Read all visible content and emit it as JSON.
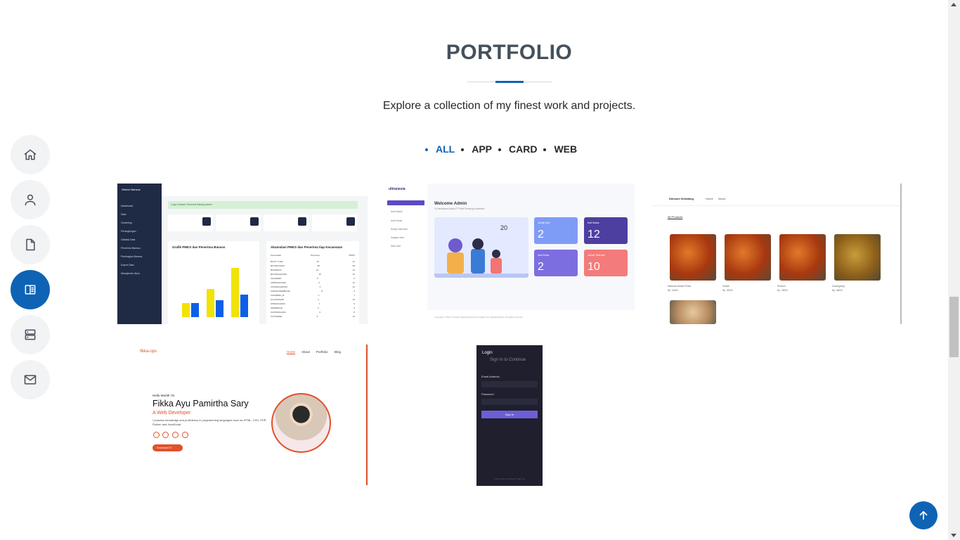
{
  "section": {
    "title": "PORTFOLIO",
    "subtitle": "Explore a collection of my finest work and projects."
  },
  "filters": [
    {
      "label": "ALL",
      "active": true
    },
    {
      "label": "APP",
      "active": false
    },
    {
      "label": "CARD",
      "active": false
    },
    {
      "label": "WEB",
      "active": false
    }
  ],
  "nav_rail": [
    {
      "icon": "home-icon",
      "active": false
    },
    {
      "icon": "person-icon",
      "active": false
    },
    {
      "icon": "file-icon",
      "active": false
    },
    {
      "icon": "book-icon",
      "active": true
    },
    {
      "icon": "server-icon",
      "active": false
    },
    {
      "icon": "envelope-icon",
      "active": false
    }
  ],
  "accent_color": "#0f63b4",
  "portfolio_items": {
    "dashboard": {
      "brand": "Sistem Bansos",
      "menu": [
        "Dashboard",
        "Data",
        "Clustering",
        "Perangkingan",
        "Validasi Data",
        "Penerima Bansos",
        "Pembagian Bansos",
        "Export Data",
        "Manajemen Akun"
      ],
      "alert": "Login Sukses! Selamat Datang Admin",
      "stats": [
        {
          "label": "Total PMKS",
          "value": "2935"
        },
        {
          "label": "Bansos Disabilitas",
          "value": "1"
        },
        {
          "label": "Bansos Disabilitas",
          "value": "180"
        },
        {
          "label": "Bansos Lansia",
          "value": "3"
        }
      ],
      "chart_title": "Grafik PMKS dan Penerima Bansos",
      "legend": [
        "PMKS",
        "Penerima"
      ],
      "chart_years": [
        "2021",
        "2022",
        "2023"
      ],
      "table_title": "Akumulasi PMKS dan Penerima tiap Kecamatan",
      "table_headers": [
        "Kecamatan",
        "Penerima",
        "PMKS"
      ],
      "table_rows": [
        [
          "BUKIT TUAR",
          "16",
          "21"
        ],
        [
          "BOJONGSARI",
          "28",
          "28"
        ],
        [
          "BUAHBATU",
          "14",
          "14"
        ],
        [
          "BOJONGSOANG",
          "16",
          "16"
        ],
        [
          "CIKAMPEK",
          "5",
          "6"
        ],
        [
          "CIBINONGSARI",
          "5",
          "12"
        ],
        [
          "CIKANGKARNATI",
          "6",
          "12"
        ],
        [
          "KARANGSEMBUNG",
          "8",
          "6"
        ],
        [
          "CIKAMPEK_B",
          "1",
          "7"
        ],
        [
          "KUJANGSARI",
          "4",
          "15"
        ],
        [
          "SINDANGSARI",
          "1",
          "3"
        ],
        [
          "GEDEBAGE",
          "4",
          "9"
        ],
        [
          "KATAPANGARA",
          "3",
          "8"
        ],
        [
          "KUTAGEDE",
          "5",
          "14"
        ]
      ]
    },
    "ultranesia": {
      "logo": "ultranesia",
      "menu_active": "Dashboard",
      "menu": [
        "Aset Masuk",
        "Aset Keluar",
        "Rekap Data Aset",
        "Kategori Aset",
        "Data User"
      ],
      "welcome": "Welcome Admin",
      "welcome_sub": "To Dashboard Admin PT Multi Teknologi Indonesia",
      "weather": "20",
      "tiles": [
        {
          "label": "Jumlah Aset",
          "value": "2",
          "color": "#7f9cf5"
        },
        {
          "label": "Aset Masuk",
          "value": "12",
          "color": "#4c3fa0"
        },
        {
          "label": "Aset Keluar",
          "value": "2",
          "color": "#7c6ee0"
        },
        {
          "label": "Jumlah Total Aset",
          "value": "10",
          "color": "#f47b7b"
        }
      ],
      "footer": "Copyright © 2023. Premium Bootstrap admin template from BootstrapDash. All rights reserved.",
      "footer_right": "Hand-crafted & made with"
    },
    "shop": {
      "brand": "Dimsum Sehatang",
      "links": [
        "Home",
        "About"
      ],
      "heading": "All Products",
      "products": [
        {
          "name": "Makaroni Bantet Pedas",
          "price": "Rp. 15000"
        },
        {
          "name": "Keripik",
          "price": "Rp. 30000"
        },
        {
          "name": "Dimsum",
          "price": "Rp. 25000"
        },
        {
          "name": "Ususngokng",
          "price": "Rp. 45000"
        }
      ]
    },
    "personal": {
      "logo": "fikka-ops",
      "links": [
        "Home",
        "About",
        "Portfolio",
        "Blog"
      ],
      "hello": "Hello World! I'm",
      "name": "Fikka Ayu Pamirtha Sary",
      "role": "A Web Developer",
      "desc": "I possess knowledge and proficiency in programming languages such as HTML, CSS, PHP, Python and JavaScript.",
      "download": "Download CV"
    },
    "login": {
      "title": "Login",
      "subtitle": "Sign In to Continue",
      "email_label": "Email Address",
      "email_placeholder": "Input your email",
      "password_label": "Password",
      "password_placeholder": "Password",
      "button": "Sign In",
      "footer": "Don't have an account? Sign Up"
    }
  }
}
